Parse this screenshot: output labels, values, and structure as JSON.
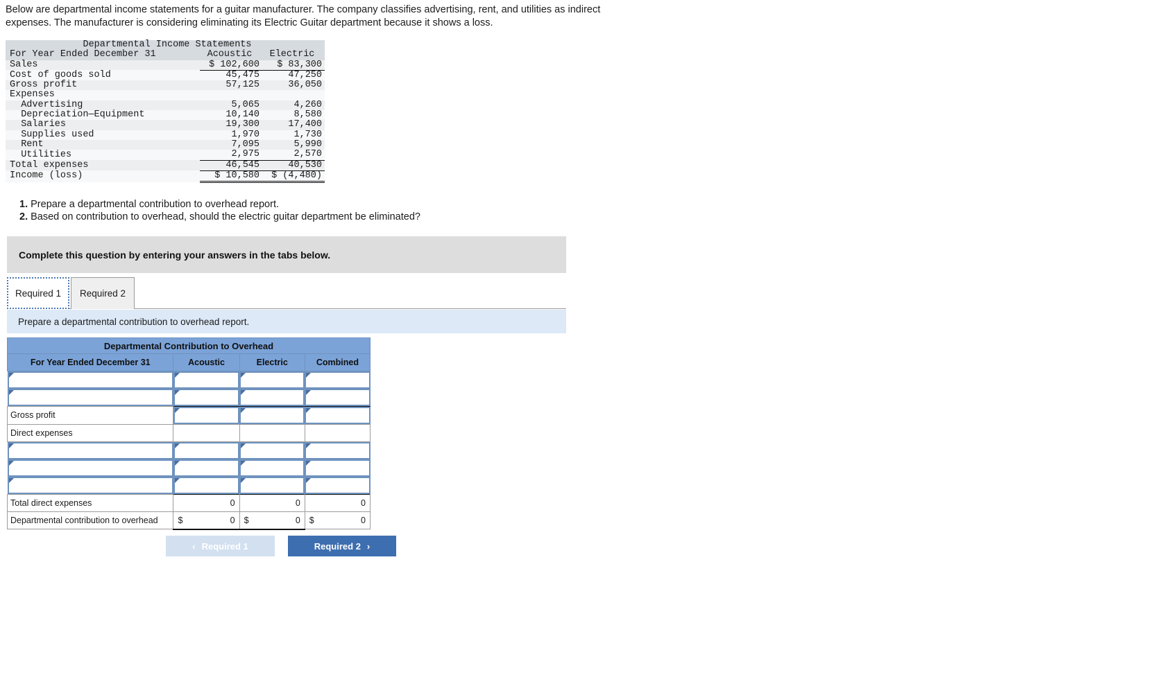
{
  "intro": {
    "paragraph": "Below are departmental income statements for a guitar manufacturer. The company classifies advertising, rent, and utilities as indirect expenses. The manufacturer is considering eliminating its Electric Guitar department because it shows a loss."
  },
  "income_statement": {
    "title": "Departmental Income Statements",
    "period_label": "For Year Ended December 31",
    "columns": [
      "Acoustic",
      "Electric"
    ],
    "rows": [
      {
        "label": "Sales",
        "acoustic": "$ 102,600",
        "electric": "$ 83,300"
      },
      {
        "label": "Cost of goods sold",
        "acoustic": "45,475",
        "electric": "47,250"
      },
      {
        "label": "Gross profit",
        "acoustic": "57,125",
        "electric": "36,050"
      },
      {
        "label": "Expenses",
        "acoustic": "",
        "electric": ""
      },
      {
        "label": "  Advertising",
        "acoustic": "5,065",
        "electric": "4,260"
      },
      {
        "label": "  Depreciation—Equipment",
        "acoustic": "10,140",
        "electric": "8,580"
      },
      {
        "label": "  Salaries",
        "acoustic": "19,300",
        "electric": "17,400"
      },
      {
        "label": "  Supplies used",
        "acoustic": "1,970",
        "electric": "1,730"
      },
      {
        "label": "  Rent",
        "acoustic": "7,095",
        "electric": "5,990"
      },
      {
        "label": "  Utilities",
        "acoustic": "2,975",
        "electric": "2,570"
      },
      {
        "label": "Total expenses",
        "acoustic": "46,545",
        "electric": "40,530"
      },
      {
        "label": "Income (loss)",
        "acoustic": "$ 10,580",
        "electric": "$ (4,480)"
      }
    ]
  },
  "requirements": {
    "num1": "1.",
    "text1": "Prepare a departmental contribution to overhead report.",
    "num2": "2.",
    "text2": "Based on contribution to overhead, should the electric guitar department be eliminated?"
  },
  "instruction_band": {
    "text": "Complete this question by entering your answers in the tabs below."
  },
  "tabs": [
    {
      "label": "Required 1",
      "active": true
    },
    {
      "label": "Required 2",
      "active": false
    }
  ],
  "sub_instruction": {
    "text": "Prepare a departmental contribution to overhead report."
  },
  "answer_table": {
    "title": "Departmental Contribution to Overhead",
    "headers": [
      "For Year Ended December 31",
      "Acoustic",
      "Electric",
      "Combined"
    ],
    "rows": [
      {
        "kind": "input",
        "label": "",
        "acoustic": "",
        "electric": "",
        "combined": ""
      },
      {
        "kind": "input",
        "label": "",
        "acoustic": "",
        "electric": "",
        "combined": ""
      },
      {
        "kind": "label_input",
        "label": "Gross profit",
        "acoustic": "",
        "electric": "",
        "combined": "",
        "rule_top": true
      },
      {
        "kind": "label_plain",
        "label": "Direct expenses",
        "acoustic": "",
        "electric": "",
        "combined": ""
      },
      {
        "kind": "input",
        "label": "",
        "acoustic": "",
        "electric": "",
        "combined": ""
      },
      {
        "kind": "input",
        "label": "",
        "acoustic": "",
        "electric": "",
        "combined": ""
      },
      {
        "kind": "input",
        "label": "",
        "acoustic": "",
        "electric": "",
        "combined": ""
      },
      {
        "kind": "total",
        "label": "Total direct expenses",
        "acoustic": "0",
        "electric": "0",
        "combined": "0"
      },
      {
        "kind": "final",
        "label": "Departmental contribution to overhead",
        "dollar": "$",
        "acoustic": "0",
        "electric": "0",
        "combined": "0"
      }
    ]
  },
  "nav": {
    "prev_label": "Required 1",
    "prev_chevron": "‹",
    "next_label": "Required 2",
    "next_chevron": "›"
  },
  "colors": {
    "header_blue": "#7ba3d8",
    "band_grey": "#dddddd",
    "band_blue": "#dde9f7",
    "btn_primary": "#3d6eb0",
    "btn_disabled": "#d3e0f0",
    "input_border": "#6f93bf"
  }
}
